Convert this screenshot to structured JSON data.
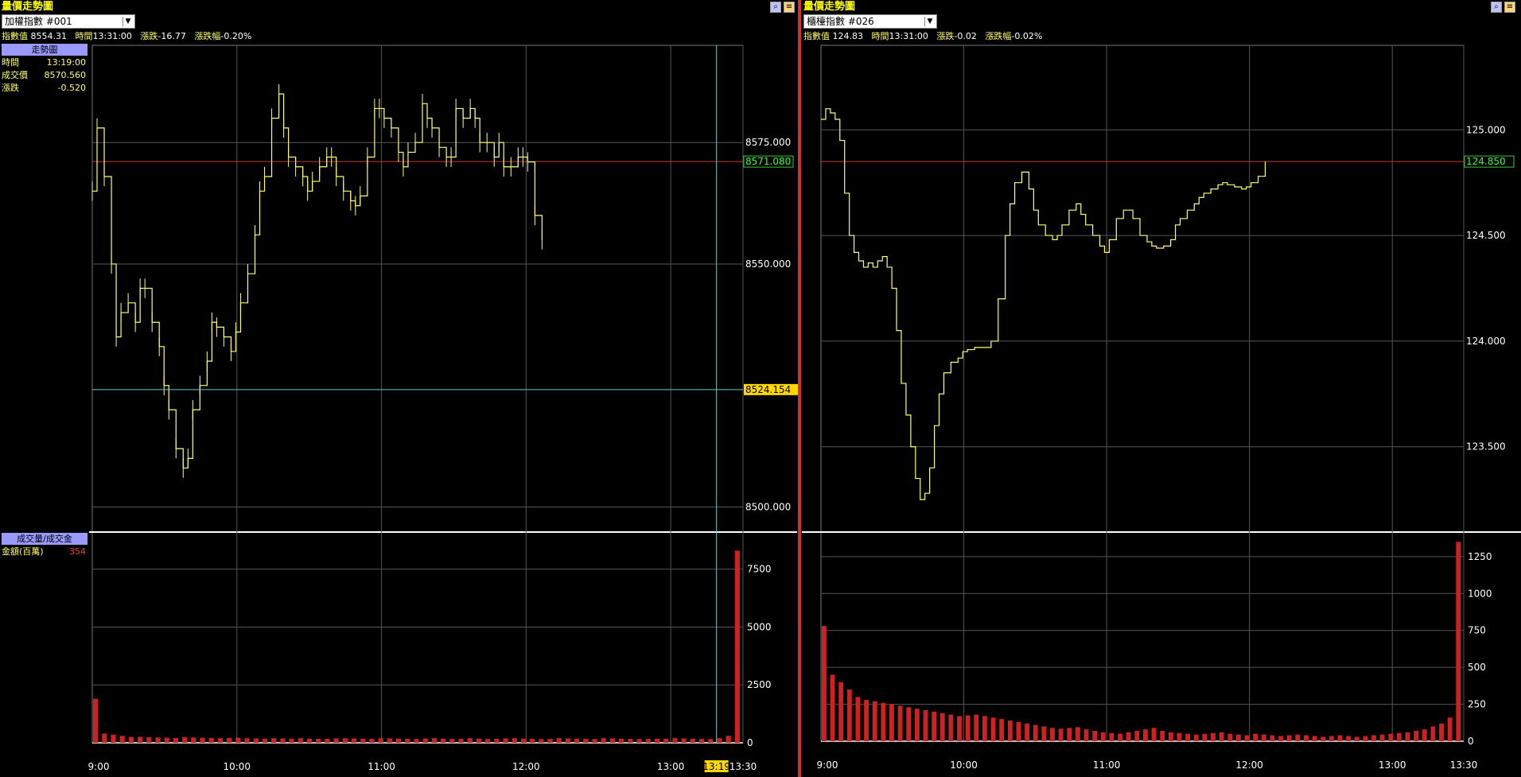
{
  "panels": [
    {
      "title": "量價走勢圖",
      "selector": "加權指數   #001",
      "info": {
        "index_label": "指數值",
        "index_value": "8554.31",
        "time_label": "時間",
        "time_value": "13:31:00",
        "change_label": "漲跌",
        "change_value": "-16.77",
        "pct_label": "漲跌幅",
        "pct_value": "-0.20%"
      },
      "sidebar": {
        "header": "走勢圖",
        "rows": [
          {
            "label": "時間",
            "value": "13:19:00"
          },
          {
            "label": "成交價",
            "value": "8570.560"
          },
          {
            "label": "漲跌",
            "value": "-0.520"
          }
        ],
        "volume_header": "成交量/成交金",
        "volume_row": {
          "label": "金額(百萬)",
          "value": "354"
        }
      },
      "price_labels": {
        "reference": "8571.080",
        "cursor": "8524.154"
      },
      "cursor_time": "13:19"
    },
    {
      "title": "量價走勢圖",
      "selector": "櫃檯指數   #026",
      "info": {
        "index_label": "指數值",
        "index_value": "124.83",
        "time_label": "時間",
        "time_value": "13:31:00",
        "change_label": "漲跌",
        "change_value": "-0.02",
        "pct_label": "漲跌幅",
        "pct_value": "-0.02%"
      },
      "price_labels": {
        "reference": "124.850"
      }
    }
  ],
  "colors": {
    "title": "#ffff00",
    "price_line": "#ffff66",
    "reference_line": "#cc3333",
    "volume_bar": "#cc2222",
    "grid": "#555555",
    "cursor": "#66cccc",
    "cursor_label_bg": "#ffd700"
  },
  "chart_data": [
    {
      "type": "line",
      "title": "",
      "x_ticks": [
        "9:00",
        "10:00",
        "11:00",
        "12:00",
        "13:00",
        "13:30"
      ],
      "y_ticks": [
        "8575.000",
        "8550.000",
        "8500.000"
      ],
      "ylim": [
        8495,
        8595
      ],
      "reference_value": 8571.08,
      "cursor_value": 8524.154,
      "series": [
        {
          "x_minutes": [
            0,
            2,
            5,
            8,
            10,
            12,
            15,
            18,
            20,
            22,
            25,
            28,
            30,
            32,
            35,
            38,
            40,
            42,
            45,
            48,
            50,
            52,
            55,
            58,
            60,
            62,
            65,
            68,
            70,
            72,
            75,
            78,
            80,
            82,
            85,
            88,
            90,
            92,
            95,
            98,
            100,
            102,
            105,
            108,
            110,
            112,
            115,
            118,
            120,
            122,
            125,
            128,
            130,
            132,
            135,
            138,
            140,
            142,
            145,
            148,
            150,
            152,
            155,
            158,
            160,
            162,
            165,
            168,
            170,
            172,
            175,
            178,
            180,
            182,
            185,
            188,
            190,
            192,
            195,
            198,
            200,
            202,
            205,
            208,
            210,
            212,
            215,
            218,
            220,
            222,
            225,
            228,
            230,
            232,
            235,
            238,
            240,
            242,
            245,
            248,
            250,
            252,
            255,
            258,
            260,
            262,
            265,
            268,
            270,
            272
          ],
          "values": [
            8565,
            8578,
            8568,
            8550,
            8535,
            8540,
            8542,
            8538,
            8545,
            8545,
            8538,
            8533,
            8525,
            8520,
            8512,
            8508,
            8510,
            8520,
            8525,
            8530,
            8538,
            8537,
            8535,
            8532,
            8536,
            8542,
            8548,
            8556,
            8565,
            8568,
            8580,
            8585,
            8578,
            8572,
            8570,
            8568,
            8565,
            8567,
            8570,
            8572,
            8572,
            8568,
            8565,
            8563,
            8562,
            8564,
            8572,
            8582,
            8582,
            8580,
            8578,
            8573,
            8570,
            8573,
            8575,
            8583,
            8580,
            8578,
            8574,
            8572,
            8572,
            8582,
            8580,
            8582,
            8580,
            8575,
            8575,
            8572,
            8575,
            8570,
            8570,
            8572,
            8572,
            8571,
            8560,
            8555
          ],
          "name": ""
        }
      ],
      "volume": {
        "y_ticks": [
          "7500",
          "5000",
          "2500",
          "0"
        ],
        "ylim": [
          0,
          9000
        ],
        "values": [
          1900,
          400,
          350,
          300,
          250,
          260,
          240,
          230,
          220,
          210,
          250,
          230,
          220,
          210,
          200,
          210,
          220,
          200,
          190,
          180,
          200,
          190,
          180,
          200,
          180,
          170,
          180,
          190,
          200,
          190,
          180,
          170,
          200,
          190,
          180,
          170,
          160,
          190,
          200,
          180,
          170,
          170,
          200,
          180,
          160,
          170,
          190,
          200,
          180,
          170,
          160,
          170,
          200,
          190,
          180,
          170,
          160,
          200,
          190,
          180,
          170,
          160,
          170,
          180,
          170,
          200,
          190,
          180,
          170,
          160,
          200,
          300,
          8300
        ]
      }
    },
    {
      "type": "line",
      "title": "",
      "x_ticks": [
        "9:00",
        "10:00",
        "11:00",
        "12:00",
        "13:00",
        "13:30"
      ],
      "y_ticks": [
        "125.000",
        "124.500",
        "124.000",
        "123.500"
      ],
      "ylim": [
        123.1,
        125.4
      ],
      "reference_value": 124.85,
      "series": [
        {
          "x_minutes": [
            0,
            2,
            4,
            6,
            8,
            10,
            12,
            14,
            16,
            18,
            20,
            22,
            24,
            26,
            28,
            30,
            32,
            34,
            36,
            38,
            40,
            42,
            44,
            46,
            48,
            50,
            52,
            55,
            58,
            60,
            62,
            65,
            68,
            70,
            72,
            75,
            78,
            80,
            82,
            85,
            88,
            90,
            92,
            95,
            98,
            100,
            102,
            105,
            108,
            110,
            112,
            115,
            118,
            120,
            122,
            125,
            128,
            130,
            132,
            135,
            138,
            140,
            142,
            145,
            148,
            150,
            152,
            155,
            158,
            160,
            162,
            165,
            168,
            170,
            172,
            175,
            178,
            180,
            182,
            185,
            188,
            190,
            192,
            195,
            198,
            200,
            202,
            205,
            208,
            210,
            212,
            215,
            218,
            220,
            222,
            225,
            228,
            230,
            232,
            235,
            238,
            240,
            242,
            245,
            248,
            250,
            252,
            255,
            258,
            260,
            262,
            265,
            268,
            270,
            272
          ],
          "values": [
            125.05,
            125.1,
            125.08,
            125.05,
            124.95,
            124.7,
            124.5,
            124.42,
            124.38,
            124.35,
            124.37,
            124.35,
            124.38,
            124.4,
            124.35,
            124.25,
            124.05,
            123.8,
            123.65,
            123.5,
            123.35,
            123.25,
            123.28,
            123.4,
            123.6,
            123.75,
            123.85,
            123.9,
            123.92,
            123.95,
            123.96,
            123.97,
            123.97,
            123.97,
            124.0,
            124.2,
            124.5,
            124.65,
            124.75,
            124.8,
            124.72,
            124.62,
            124.55,
            124.5,
            124.48,
            124.5,
            124.55,
            124.62,
            124.65,
            124.6,
            124.55,
            124.5,
            124.45,
            124.42,
            124.48,
            124.58,
            124.62,
            124.62,
            124.58,
            124.5,
            124.47,
            124.45,
            124.44,
            124.45,
            124.48,
            124.55,
            124.58,
            124.62,
            124.65,
            124.68,
            124.7,
            124.72,
            124.74,
            124.75,
            124.74,
            124.73,
            124.72,
            124.73,
            124.75,
            124.78,
            124.85
          ],
          "name": ""
        }
      ],
      "volume": {
        "y_ticks": [
          "1250",
          "1000",
          "750",
          "500",
          "250",
          "0"
        ],
        "ylim": [
          0,
          1400
        ],
        "values": [
          780,
          450,
          400,
          350,
          300,
          280,
          270,
          260,
          250,
          240,
          230,
          220,
          210,
          200,
          190,
          180,
          170,
          175,
          180,
          170,
          160,
          150,
          140,
          130,
          120,
          110,
          100,
          90,
          85,
          90,
          95,
          80,
          70,
          60,
          55,
          50,
          60,
          70,
          80,
          90,
          70,
          60,
          55,
          50,
          45,
          50,
          55,
          60,
          50,
          45,
          40,
          50,
          45,
          40,
          35,
          40,
          45,
          40,
          35,
          30,
          35,
          40,
          35,
          30,
          35,
          40,
          45,
          50,
          55,
          60,
          70,
          80,
          100,
          120,
          160,
          1350
        ]
      }
    }
  ]
}
